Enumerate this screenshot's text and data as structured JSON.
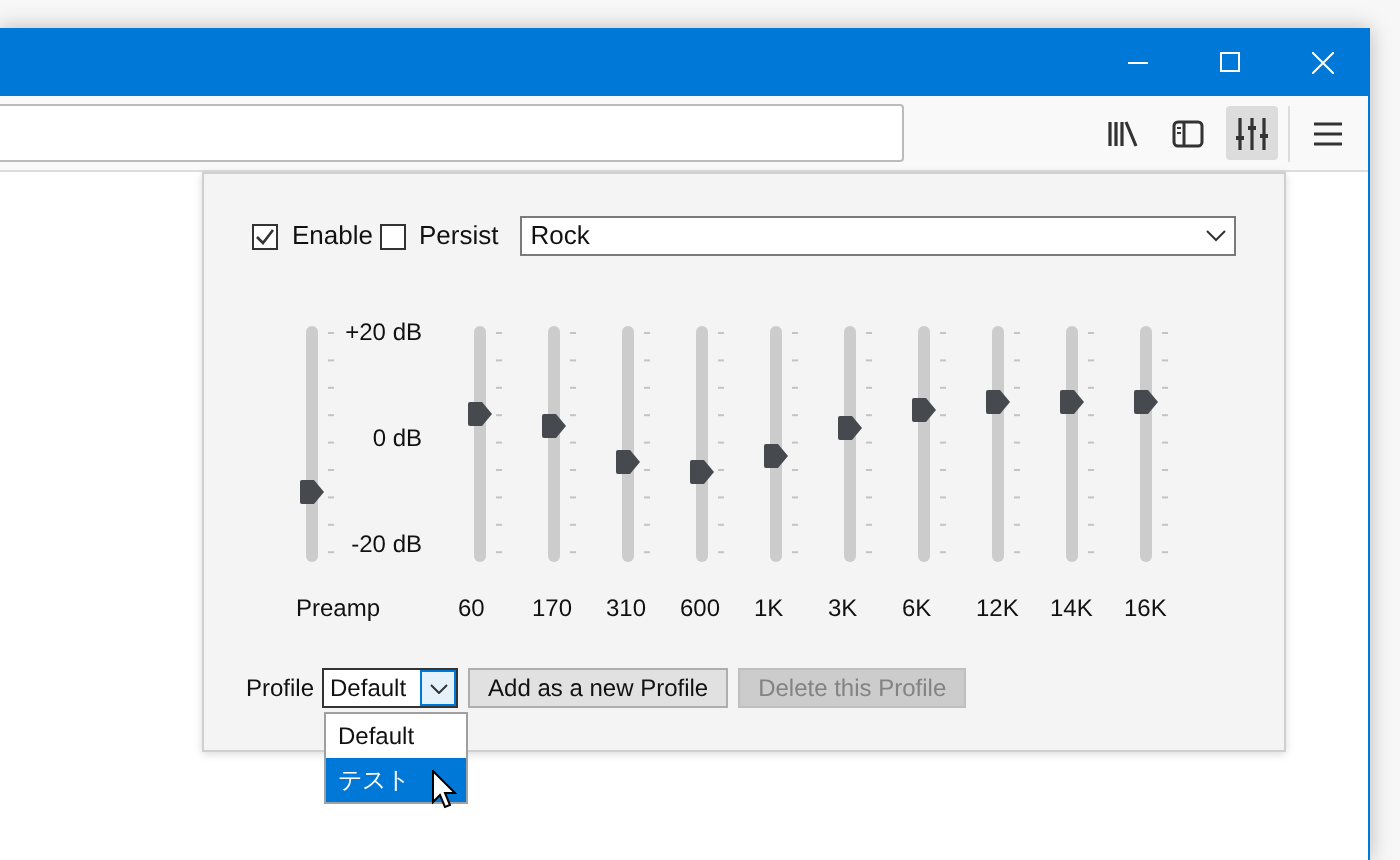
{
  "equalizer": {
    "enable": {
      "label": "Enable",
      "checked": true
    },
    "persist": {
      "label": "Persist",
      "checked": false
    },
    "preset": {
      "value": "Rock"
    },
    "scale_labels": [
      "+20 dB",
      "0 dB",
      "-20 dB"
    ],
    "preamp": {
      "label": "Preamp",
      "level": 0.3
    },
    "bands": [
      {
        "label": "60",
        "level": 0.63
      },
      {
        "label": "170",
        "level": 0.58
      },
      {
        "label": "310",
        "level": 0.42
      },
      {
        "label": "600",
        "level": 0.38
      },
      {
        "label": "1K",
        "level": 0.45
      },
      {
        "label": "3K",
        "level": 0.57
      },
      {
        "label": "6K",
        "level": 0.64
      },
      {
        "label": "12K",
        "level": 0.68
      },
      {
        "label": "14K",
        "level": 0.68
      },
      {
        "label": "16K",
        "level": 0.68
      }
    ],
    "profile": {
      "label": "Profile",
      "value": "Default",
      "expanded": true,
      "options": [
        {
          "label": "Default",
          "highlighted": false
        },
        {
          "label": "テスト",
          "highlighted": true
        }
      ]
    },
    "buttons": [
      {
        "label": "Add as a new Profile",
        "disabled": false
      },
      {
        "label": "Delete this Profile",
        "disabled": true
      }
    ]
  }
}
